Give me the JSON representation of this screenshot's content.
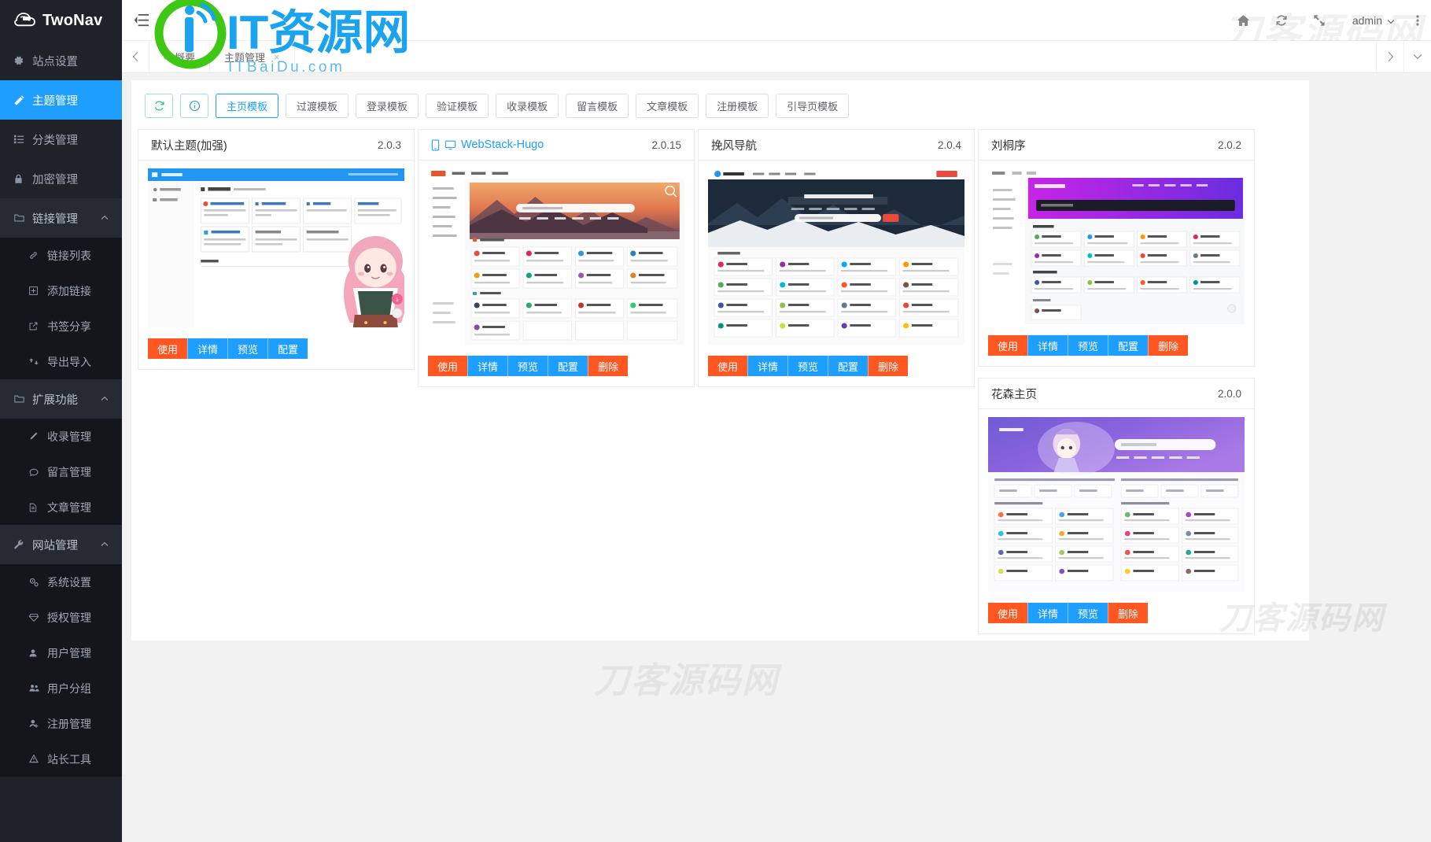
{
  "brand": {
    "name": "TwoNav",
    "logo_icon": "cloud-leaf-logo"
  },
  "watermarks": {
    "top": "刀客源码网",
    "middle": "刀客源码网",
    "card": "刀客源码网",
    "overlay_logo_main": "IT资源网",
    "overlay_logo_sub": "ITBaiDu.com"
  },
  "sidebar": {
    "items": [
      {
        "label": "站点设置",
        "icon": "gear-icon",
        "type": "item",
        "state": "normal"
      },
      {
        "label": "主题管理",
        "icon": "magic-wand-icon",
        "type": "item",
        "state": "active"
      },
      {
        "label": "分类管理",
        "icon": "list-icon",
        "type": "item",
        "state": "normal"
      },
      {
        "label": "加密管理",
        "icon": "lock-icon",
        "type": "item",
        "state": "normal"
      },
      {
        "label": "链接管理",
        "icon": "folder-icon",
        "type": "group",
        "state": "expanded",
        "caret": "chevron-up-icon"
      },
      {
        "label": "链接列表",
        "icon": "link-icon",
        "type": "sub"
      },
      {
        "label": "添加链接",
        "icon": "plus-square-icon",
        "type": "sub"
      },
      {
        "label": "书签分享",
        "icon": "external-link-icon",
        "type": "sub"
      },
      {
        "label": "导出导入",
        "icon": "exchange-icon",
        "type": "sub"
      },
      {
        "label": "扩展功能",
        "icon": "folder-icon",
        "type": "group",
        "state": "expanded",
        "caret": "chevron-up-icon"
      },
      {
        "label": "收录管理",
        "icon": "pencil-icon",
        "type": "sub"
      },
      {
        "label": "留言管理",
        "icon": "comment-icon",
        "type": "sub"
      },
      {
        "label": "文章管理",
        "icon": "file-icon",
        "type": "sub"
      },
      {
        "label": "网站管理",
        "icon": "wrench-icon",
        "type": "group",
        "state": "expanded",
        "caret": "chevron-up-icon"
      },
      {
        "label": "系统设置",
        "icon": "gears-icon",
        "type": "sub"
      },
      {
        "label": "授权管理",
        "icon": "diamond-icon",
        "type": "sub"
      },
      {
        "label": "用户管理",
        "icon": "user-icon",
        "type": "sub"
      },
      {
        "label": "用户分组",
        "icon": "users-icon",
        "type": "sub"
      },
      {
        "label": "注册管理",
        "icon": "user-plus-icon",
        "type": "sub"
      },
      {
        "label": "站长工具",
        "icon": "warning-triangle-icon",
        "type": "sub"
      }
    ]
  },
  "header": {
    "collapse_icon": "menu-collapse-icon",
    "icons": [
      {
        "name": "home-icon"
      },
      {
        "name": "refresh-icon"
      },
      {
        "name": "fullscreen-icon"
      }
    ],
    "user": "admin",
    "user_caret": "chevron-down-icon",
    "more_icon": "more-vertical-icon"
  },
  "tabbar": {
    "prev_icon": "chevron-left-icon",
    "next_icon": "chevron-right-icon",
    "dropdown_icon": "chevron-down-icon",
    "tabs": [
      {
        "label": "概要",
        "closable": false,
        "active": false,
        "dot": true
      },
      {
        "label": "主题管理",
        "closable": true,
        "active": true,
        "dot": false,
        "close": "×"
      }
    ]
  },
  "toolbar": {
    "refresh_icon": "refresh-icon",
    "info_icon": "info-circle-icon",
    "buttons": [
      {
        "label": "主页模板",
        "selected": true
      },
      {
        "label": "过渡模板",
        "selected": false
      },
      {
        "label": "登录模板",
        "selected": false
      },
      {
        "label": "验证模板",
        "selected": false
      },
      {
        "label": "收录模板",
        "selected": false
      },
      {
        "label": "留言模板",
        "selected": false
      },
      {
        "label": "文章模板",
        "selected": false
      },
      {
        "label": "注册模板",
        "selected": false
      },
      {
        "label": "引导页模板",
        "selected": false
      }
    ]
  },
  "cards": {
    "c1": {
      "title": "默认主题(加强)",
      "version": "2.0.3",
      "has_device_icons": false,
      "is_link": false,
      "actions": [
        {
          "label": "使用",
          "style": "use"
        },
        {
          "label": "详情",
          "style": "blue"
        },
        {
          "label": "预览",
          "style": "blue"
        },
        {
          "label": "配置",
          "style": "blue"
        }
      ]
    },
    "c2": {
      "title": "WebStack-Hugo",
      "version": "2.0.15",
      "has_device_icons": true,
      "is_link": true,
      "device_icons": [
        "mobile-icon",
        "desktop-icon"
      ],
      "actions": [
        {
          "label": "使用",
          "style": "use"
        },
        {
          "label": "详情",
          "style": "blue"
        },
        {
          "label": "预览",
          "style": "blue"
        },
        {
          "label": "配置",
          "style": "blue"
        },
        {
          "label": "删除",
          "style": "del"
        }
      ]
    },
    "c3": {
      "title": "挽风导航",
      "version": "2.0.4",
      "has_device_icons": false,
      "is_link": false,
      "actions": [
        {
          "label": "使用",
          "style": "use"
        },
        {
          "label": "详情",
          "style": "blue"
        },
        {
          "label": "预览",
          "style": "blue"
        },
        {
          "label": "配置",
          "style": "blue"
        },
        {
          "label": "删除",
          "style": "del"
        }
      ]
    },
    "c4": {
      "title": "刘桐序",
      "version": "2.0.2",
      "has_device_icons": false,
      "is_link": false,
      "actions": [
        {
          "label": "使用",
          "style": "use"
        },
        {
          "label": "详情",
          "style": "blue"
        },
        {
          "label": "预览",
          "style": "blue"
        },
        {
          "label": "配置",
          "style": "blue"
        },
        {
          "label": "删除",
          "style": "del"
        }
      ]
    },
    "c5": {
      "title": "花森主页",
      "version": "2.0.0",
      "has_device_icons": false,
      "is_link": false,
      "actions": [
        {
          "label": "使用",
          "style": "use"
        },
        {
          "label": "详情",
          "style": "blue"
        },
        {
          "label": "预览",
          "style": "blue"
        },
        {
          "label": "删除",
          "style": "del"
        }
      ]
    }
  },
  "colors": {
    "sidebar_bg": "#20222a",
    "sidebar_sub_bg": "#14161c",
    "accent_blue": "#1E9FFF",
    "accent_orange": "#FF5722",
    "page_bg": "#f2f2f2"
  }
}
